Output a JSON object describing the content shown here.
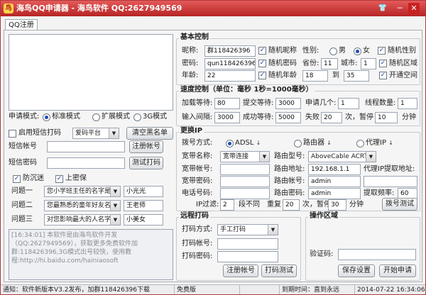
{
  "window": {
    "title": "海鸟QQ申请器 - 海鸟软件 QQ:2627949569",
    "logo": "鸟",
    "skin": "👕",
    "min": "─",
    "close": "✕"
  },
  "tab": "QQ注册",
  "left": {
    "mode_label": "申请模式:",
    "modes": [
      "标准模式",
      "扩展模式",
      "3G模式"
    ],
    "sms_checkbox": "启用短信打码",
    "sms_platform": "爱码平台",
    "clear_blacklist": "清空黑名单",
    "sms_account_label": "短信帐号",
    "sms_register_button": "注册帐号",
    "sms_password_label": "短信密码",
    "sms_test_button": "测试打码",
    "anti_lost_label": "防沉迷",
    "secure_label": "上密保",
    "q1_label": "问题一",
    "q1_value": "您小学班主任的名字是",
    "a1_value": "小光光",
    "q2_label": "问题二",
    "q2_value": "您最熟悉的童年好友名",
    "a2_value": "王老师",
    "q3_label": "问题三",
    "q3_value": "对您影响最大的人名字",
    "a3_value": "小美女",
    "log_text": "[16:34:01] 本软件是由海鸟软件开发（QQ:2627949569），获取更多免费软件加群:118426396,3G模式出号较快，使用教程:http://hi.baidu.com/hainiaosoft"
  },
  "basic": {
    "title": "基本控制",
    "nick_label": "昵称:",
    "nick_value": "群118426396",
    "nick_random": "随机昵称",
    "gender_label": "性别:",
    "male": "男",
    "female": "女",
    "gender_random": "随机性别",
    "pwd_label": "密码:",
    "pwd_value": "qun118426396",
    "pwd_random": "随机密码",
    "province_label": "省份:",
    "province_value": "11",
    "city_label": "城市:",
    "city_value": "1",
    "area_random": "随机区域",
    "age_label": "年龄:",
    "age_value": "22",
    "age_random": "随机年龄",
    "age_from": "18",
    "age_to_label": "到",
    "age_to": "35",
    "open_space": "开通空间"
  },
  "speed": {
    "title": "速度控制（单位：毫秒 1秒=1000毫秒）",
    "load_wait_label": "加载等待:",
    "load_wait": "80",
    "submit_wait_label": "提交等待:",
    "submit_wait": "3000",
    "apply_count_label": "申请几个:",
    "apply_count": "1",
    "threads_label": "线程数量:",
    "threads": "1",
    "input_interval_label": "输入间隔:",
    "input_interval": "3000",
    "success_wait_label": "成功等待:",
    "success_wait": "5000",
    "fail_label": "失败",
    "fail_count": "20",
    "pause_label": "次，暂停",
    "pause_minutes": "10",
    "minutes_label": "分钟"
  },
  "ip": {
    "title": "更换IP",
    "dial_label": "拨号方式:",
    "adsl": "ADSL",
    "router": "路由器",
    "proxy": "代理IP",
    "broadband_name_label": "宽带名称:",
    "broadband_name": "宽带连接",
    "router_model_label": "路由型号:",
    "router_model": "AboveCable ACRT2010",
    "broadband_account_label": "宽带帐号:",
    "router_addr_label": "路由地址:",
    "router_addr": "192.168.1.1",
    "proxy_addr_label": "代理IP提取地址:",
    "broadband_pwd_label": "宽带密码:",
    "router_account_label": "路由帐号:",
    "router_account": "admin",
    "phone_label": "电话号码:",
    "router_pwd_label": "路由密码:",
    "router_pwd": "admin",
    "fetch_freq_label": "提取频率:",
    "fetch_freq": "60",
    "ip_over_label": "IP过滤:",
    "ip_over": "2",
    "seg_diff_label": "段不同",
    "retry_label": "重复",
    "retry": "20",
    "times_pause_label": "次，暂停",
    "pause_min": "30",
    "minutes_label": "分钟",
    "dial_test": "拨号测试"
  },
  "remote": {
    "title": "远程打码",
    "mode_label": "打码方式:",
    "mode_value": "手工打码",
    "account_label": "打码帐号:",
    "pwd_label": "打码密码:",
    "register": "注册帐号",
    "test": "打码测试"
  },
  "ops": {
    "title": "操作区域",
    "captcha_label": "验证码:",
    "save": "保存设置",
    "start": "开始申请"
  },
  "status": {
    "notice": "通知：软件新版本V3.2发布，加群118426396下载",
    "edition": "免费版",
    "expire": "到期时间：直到永远",
    "datetime": "2014-07-22 16:34:06"
  }
}
